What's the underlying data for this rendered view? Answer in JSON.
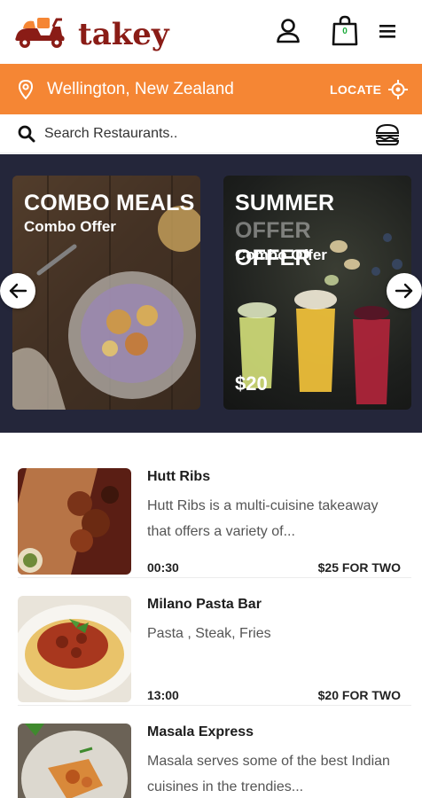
{
  "header": {
    "logo_text": "takey",
    "cart_count": "0"
  },
  "location": {
    "city": "Wellington, New Zealand",
    "locate_label": "LOCATE"
  },
  "search": {
    "placeholder": "Search Restaurants.."
  },
  "banners": [
    {
      "title": "COMBO MEALS",
      "subtitle": "Combo Offer",
      "price": ""
    },
    {
      "title_main": "SUMMER",
      "title_faded": "OFFER",
      "title_line2": "OFFER",
      "subtitle": "Combo Offer",
      "price": "$20"
    }
  ],
  "restaurants": [
    {
      "name": "Hutt Ribs",
      "description": "Hutt Ribs is a multi-cuisine takeaway that offers a variety of...",
      "time": "00:30",
      "price": "$25 FOR TWO"
    },
    {
      "name": "Milano Pasta Bar",
      "description": "Pasta , Steak, Fries",
      "time": "13:00",
      "price": "$20 FOR TWO"
    },
    {
      "name": "Masala Express",
      "description": "Masala serves some of the best Indian cuisines in the trendies...",
      "time": "",
      "price": ""
    }
  ],
  "colors": {
    "brand_orange": "#f58634",
    "brand_red": "#8a1c16",
    "banner_bg": "#24263a",
    "cart_badge": "#1bab3a"
  },
  "icons": [
    "scooter-logo-icon",
    "user-icon",
    "shopping-bag-icon",
    "hamburger-menu-icon",
    "location-pin-icon",
    "crosshair-icon",
    "search-icon",
    "burger-food-icon",
    "arrow-left-icon",
    "arrow-right-icon"
  ]
}
